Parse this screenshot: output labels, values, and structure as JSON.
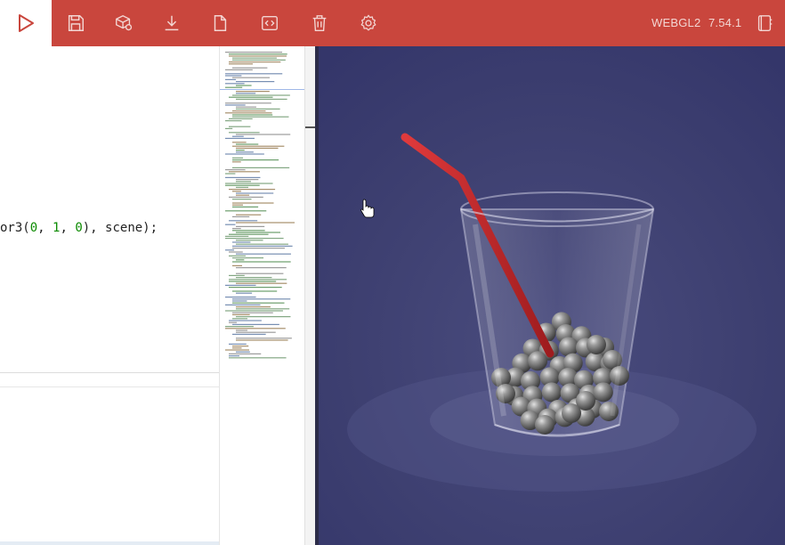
{
  "toolbar": {
    "engine_label": "WEBGL2",
    "version_label": "7.54.1",
    "buttons": {
      "run": "run",
      "save": "save",
      "inspector": "inspector",
      "download": "download",
      "new": "new",
      "format": "format",
      "clear": "clear",
      "settings": "settings",
      "examples": "examples"
    }
  },
  "editor": {
    "code_prefix": "or3(",
    "code_a": "0",
    "code_sep1": ", ",
    "code_b": "1",
    "code_sep2": ", ",
    "code_c": "0",
    "code_suffix": "), scene);"
  },
  "scene": {
    "background_color": "#3b3d6e",
    "straw_color": "#c8282a",
    "ball_color": "#8a8a8a",
    "cursor_icon": "hand-pointer-icon"
  }
}
